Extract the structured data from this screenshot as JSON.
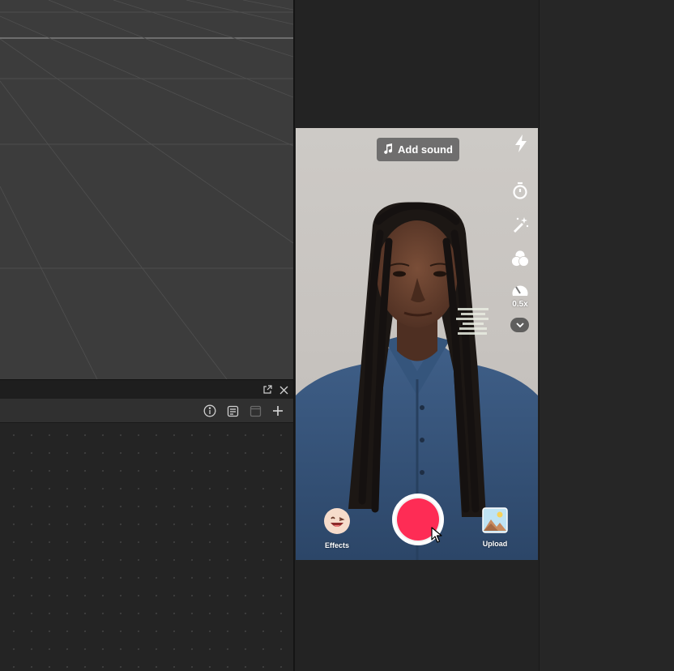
{
  "viewport": {
    "name": "3d-viewport"
  },
  "panel": {
    "titlebar_icons": [
      "popout-icon",
      "close-icon"
    ],
    "toolbar_icons": [
      "info-icon",
      "list-panel-icon",
      "window-icon",
      "plus-icon"
    ]
  },
  "camera": {
    "add_sound_label": "Add sound",
    "speed_label": "0.5x",
    "effects_label": "Effects",
    "upload_label": "Upload",
    "record_color": "#fe2c55",
    "side_icons": [
      "flash-icon",
      "timer-icon",
      "beauty-wand-icon",
      "filters-icon",
      "speed-icon",
      "chevron-down-icon"
    ]
  },
  "colors": {
    "viewport_bg": "#3c3c3c",
    "panel_bg": "#242424",
    "accent_record": "#fe2c55"
  }
}
